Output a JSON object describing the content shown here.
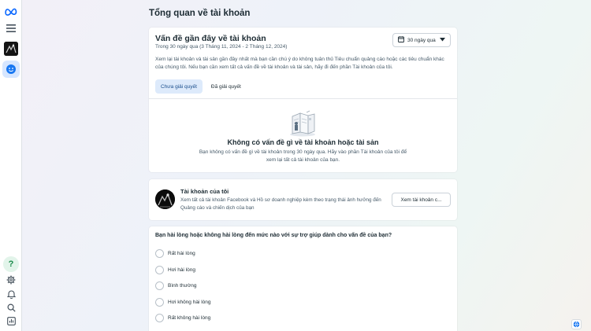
{
  "colors": {
    "accent": "#1a4e8c",
    "tab_active_bg": "#ddeafb",
    "card_bg": "#ffffff",
    "text_primary": "#1c2b33",
    "text_secondary": "#465a69"
  },
  "rail": {
    "logo": "meta-logo-icon",
    "items": [
      "menu-icon",
      "account-avatar",
      "account-quality-icon"
    ],
    "bottom_items": [
      "help-icon",
      "settings-icon",
      "notifications-icon",
      "search-icon",
      "reports-icon"
    ],
    "help_label": "?"
  },
  "page": {
    "title": "Tổng quan về tài khoản"
  },
  "issues": {
    "title": "Vấn đề gần đây về tài khoản",
    "subtitle": "Trong 30 ngày qua (3 Tháng 11, 2024 - 2 Tháng 12, 2024)",
    "date_filter": "30 ngày qua",
    "description": "Xem lại tài khoản và tài sản gần đây nhất mà bạn cần chú ý do không tuân thủ Tiêu chuẩn quảng cáo hoặc các tiêu chuẩn khác của chúng tôi. Nếu bạn cần xem tất cả vấn đề về tài khoản và tài sản, hãy đi đến phần Tài khoản của tôi.",
    "tabs": [
      {
        "label": "Chưa giải quyết",
        "active": true
      },
      {
        "label": "Đã giải quyết",
        "active": false
      }
    ],
    "empty_title": "Không có vấn đề gì về tài khoản hoặc tài sản",
    "empty_desc": "Bạn không có vấn đề gì về tài khoản trong 30 ngày qua. Hãy vào phần Tài khoản của tôi để xem lại tất cả tài khoản của bạn."
  },
  "my_accounts": {
    "title": "Tài khoản của tôi",
    "description": "Xem tất cả tài khoản Facebook và Hồ sơ doanh nghiệp kèm theo trạng thái ảnh hưởng đến Quảng cáo và chiến dịch của bạn",
    "button": "Xem tài khoản c..."
  },
  "survey": {
    "question": "Bạn hài lòng hoặc không hài lòng đến mức nào với sự trợ giúp dành cho vấn đề của bạn?",
    "options": [
      "Rất hài lòng",
      "Hơi hài lòng",
      "Bình thường",
      "Hơi không hài lòng",
      "Rất không hài lòng"
    ]
  },
  "footer": {
    "language_icon": "globe-icon"
  }
}
